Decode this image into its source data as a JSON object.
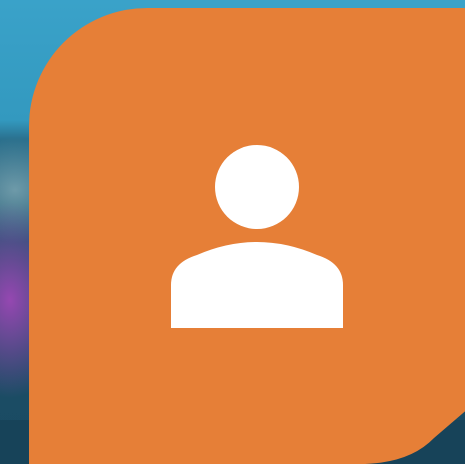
{
  "colors": {
    "tile_background": "#e67f37",
    "icon_fill": "#ffffff",
    "wallpaper_top": "#3aa2c9",
    "wallpaper_bottom": "#1a4a62",
    "wallpaper_accent": "#a946be"
  },
  "tile": {
    "icon": "user-account-icon"
  }
}
